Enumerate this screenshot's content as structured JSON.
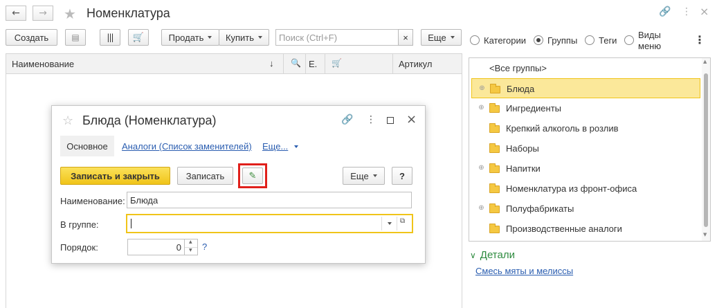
{
  "window": {
    "title": "Номенклатура"
  },
  "toolbar": {
    "create_label": "Создать",
    "sell_label": "Продать",
    "buy_label": "Купить",
    "search_placeholder": "Поиск (Ctrl+F)",
    "search_clear": "×",
    "more_label": "Еще"
  },
  "view_options": {
    "categories": "Категории",
    "groups": "Группы",
    "tags": "Теги",
    "menu_views_line1": "Виды",
    "menu_views_line2": "меню",
    "selected": "Группы"
  },
  "table": {
    "columns": [
      "Наименование",
      "↓",
      "Е.",
      "Артикул"
    ]
  },
  "groups": {
    "items": [
      {
        "label": "<Все группы>",
        "expandable": false,
        "folder": false,
        "selected": false
      },
      {
        "label": "Блюда",
        "expandable": true,
        "folder": true,
        "selected": true
      },
      {
        "label": "Ингредиенты",
        "expandable": true,
        "folder": true,
        "selected": false
      },
      {
        "label": "Крепкий алкоголь в розлив",
        "expandable": false,
        "folder": true,
        "selected": false
      },
      {
        "label": "Наборы",
        "expandable": false,
        "folder": true,
        "selected": false
      },
      {
        "label": "Напитки",
        "expandable": true,
        "folder": true,
        "selected": false
      },
      {
        "label": "Номенклатура из фронт-офиса",
        "expandable": false,
        "folder": true,
        "selected": false
      },
      {
        "label": "Полуфабрикаты",
        "expandable": true,
        "folder": true,
        "selected": false
      },
      {
        "label": "Производственные аналоги",
        "expandable": false,
        "folder": true,
        "selected": false
      }
    ]
  },
  "details": {
    "title": "Детали",
    "link": "Смесь мяты и мелиссы"
  },
  "dialog": {
    "title": "Блюда (Номенклатура)",
    "tabs": {
      "main": "Основное",
      "analogs": "Аналоги (Список заменителей)",
      "more": "Еще..."
    },
    "buttons": {
      "save_close": "Записать и закрыть",
      "save": "Записать",
      "more": "Еще",
      "help": "?"
    },
    "fields": {
      "name_label": "Наименование:",
      "name_value": "Блюда",
      "group_label": "В группе:",
      "group_value": "",
      "order_label": "Порядок:",
      "order_value": "0",
      "order_help": "?"
    }
  },
  "colors": {
    "accent_yellow": "#f6cf2a",
    "selected_row": "#fbe89a",
    "link_blue": "#2a5db0",
    "details_green": "#2e8b3f",
    "highlight_red": "#e0201b"
  }
}
